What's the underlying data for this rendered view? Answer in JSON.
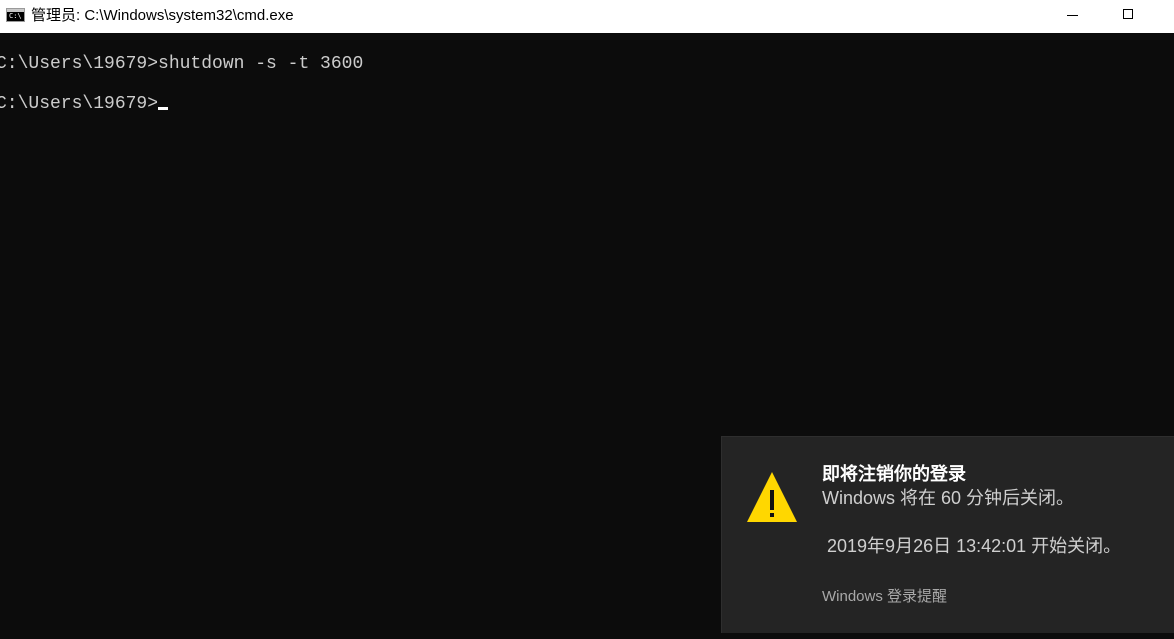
{
  "window": {
    "title": "管理员: C:\\Windows\\system32\\cmd.exe",
    "icon": "cmd-icon",
    "icon_text": "C:\\",
    "buttons": [
      "minimize-icon",
      "maximize-icon"
    ]
  },
  "console": {
    "lines": [
      "C:\\Users\\19679>shutdown -s -t 3600",
      "C:\\Users\\19679>"
    ],
    "text_color": "#cccccc",
    "background": "#0c0c0c"
  },
  "toast": {
    "icon": "warning-icon",
    "icon_color": "#ffd700",
    "title": "即将注销你的登录",
    "body": "Windows 将在 60 分钟后关闭。",
    "time_text": " 2019年9月26日 13:42:01 开始关闭。",
    "source": "Windows 登录提醒",
    "background": "#242424"
  }
}
